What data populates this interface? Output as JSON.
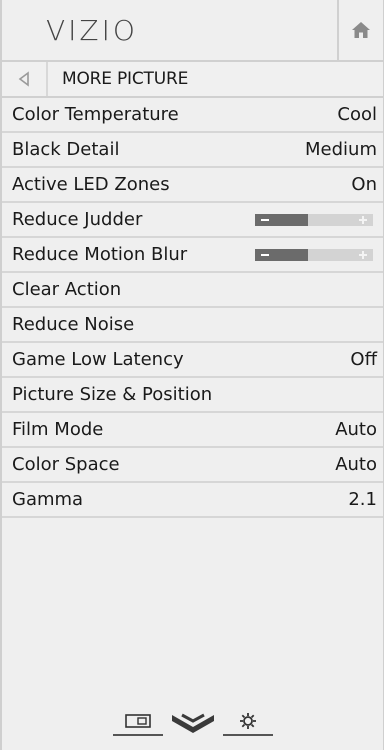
{
  "header": {
    "logo": "VIZIO",
    "home_icon": "home-icon"
  },
  "subheader": {
    "back_icon": "back-triangle-icon",
    "title": "MORE PICTURE"
  },
  "menu": [
    {
      "label": "Color Temperature",
      "value": "Cool"
    },
    {
      "label": "Black Detail",
      "value": "Medium"
    },
    {
      "label": "Active LED Zones",
      "value": "On"
    },
    {
      "label": "Reduce Judder",
      "slider_level": 0.45
    },
    {
      "label": "Reduce Motion Blur",
      "slider_level": 0.45
    },
    {
      "label": "Clear Action",
      "value": ""
    },
    {
      "label": "Reduce Noise",
      "value": ""
    },
    {
      "label": "Game Low Latency",
      "value": "Off"
    },
    {
      "label": "Picture Size & Position",
      "value": ""
    },
    {
      "label": "Film Mode",
      "value": "Auto"
    },
    {
      "label": "Color Space",
      "value": "Auto"
    },
    {
      "label": "Gamma",
      "value": "2.1"
    }
  ],
  "footer": {
    "icons": [
      "input-icon",
      "vizio-v-icon",
      "settings-gear-icon"
    ]
  },
  "colors": {
    "background": "#efefef",
    "divider": "#d6d6d6",
    "slider_fill": "#6b6b6b",
    "slider_track": "#d3d3d3"
  }
}
